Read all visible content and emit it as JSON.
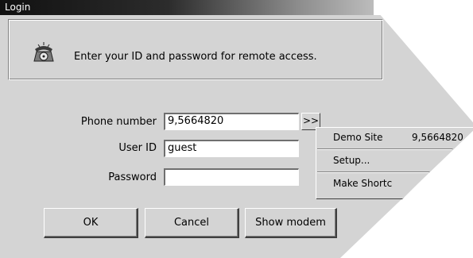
{
  "window": {
    "title": "Login"
  },
  "info": {
    "message": "Enter your ID and password for remote access."
  },
  "form": {
    "phone_label": "Phone number",
    "phone_value": "9,5664820",
    "userid_label": "User ID",
    "userid_value": "guest",
    "password_label": "Password",
    "password_value": "",
    "phone_menu_button": ">>"
  },
  "buttons": {
    "ok": "OK",
    "cancel": "Cancel",
    "show_modem": "Show modem"
  },
  "menu": {
    "items": [
      {
        "label": "Demo Site",
        "value": "9,5664820"
      },
      {
        "label": "Setup..."
      },
      {
        "label": "Make Shortc"
      }
    ]
  },
  "icons": {
    "info_icon": "telephone-icon"
  }
}
